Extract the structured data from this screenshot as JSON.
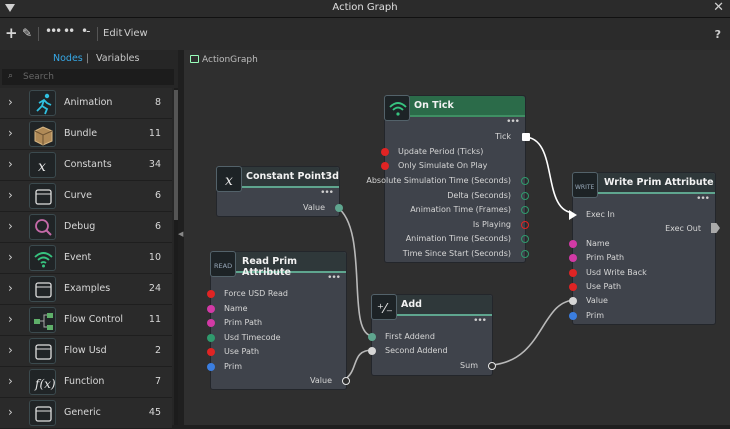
{
  "window": {
    "title": "Action Graph"
  },
  "toolbar": {
    "edit": "Edit",
    "view": "View",
    "help": "?"
  },
  "sidebar": {
    "tabs": [
      "Nodes",
      "Variables"
    ],
    "search_placeholder": "Search",
    "categories": [
      {
        "name": "Animation",
        "count": "8",
        "icon": "running-figure-icon"
      },
      {
        "name": "Bundle",
        "count": "11",
        "icon": "box-icon"
      },
      {
        "name": "Constants",
        "count": "34",
        "icon": "x-variable-icon"
      },
      {
        "name": "Curve",
        "count": "6",
        "icon": "curve-icon"
      },
      {
        "name": "Debug",
        "count": "6",
        "icon": "magnifier-icon"
      },
      {
        "name": "Event",
        "count": "10",
        "icon": "wifi-icon"
      },
      {
        "name": "Examples",
        "count": "24",
        "icon": "document-icon"
      },
      {
        "name": "Flow Control",
        "count": "11",
        "icon": "flow-icon"
      },
      {
        "name": "Flow Usd",
        "count": "2",
        "icon": "document-icon"
      },
      {
        "name": "Function",
        "count": "7",
        "icon": "function-icon"
      },
      {
        "name": "Generic",
        "count": "45",
        "icon": "document-icon"
      }
    ]
  },
  "canvas": {
    "breadcrumb": "ActionGraph",
    "nodes": {
      "on_tick": {
        "title": "On Tick",
        "out": "Tick",
        "ports": [
          "Update Period (Ticks)",
          "Only Simulate On Play",
          "Absolute Simulation Time (Seconds)",
          "Delta (Seconds)",
          "Animation Time (Frames)",
          "Is Playing",
          "Animation Time (Seconds)",
          "Time Since Start (Seconds)"
        ]
      },
      "constant": {
        "title": "Constant Point3d",
        "out": "Value"
      },
      "read": {
        "title": "Read Prim Attribute",
        "badge": "READ",
        "ports": [
          "Force USD Read",
          "Name",
          "Prim Path",
          "Usd Timecode",
          "Use Path",
          "Prim"
        ],
        "out": "Value"
      },
      "add": {
        "title": "Add",
        "ports": [
          "First Addend",
          "Second Addend"
        ],
        "out": "Sum"
      },
      "write": {
        "title": "Write Prim Attribute",
        "badge": "WRITE",
        "exec_in": "Exec In",
        "exec_out": "Exec Out",
        "ports": [
          "Name",
          "Prim Path",
          "Usd Write Back",
          "Use Path",
          "Value",
          "Prim"
        ]
      }
    }
  },
  "colors": {
    "accent": "#36a8e6",
    "header_green": "#2b6b49",
    "pin_red": "#e02424",
    "pin_pink": "#d23aa6",
    "pin_green": "#2f9a6d",
    "pin_blue": "#3b7ee0",
    "pin_white": "#e6e6e6"
  }
}
